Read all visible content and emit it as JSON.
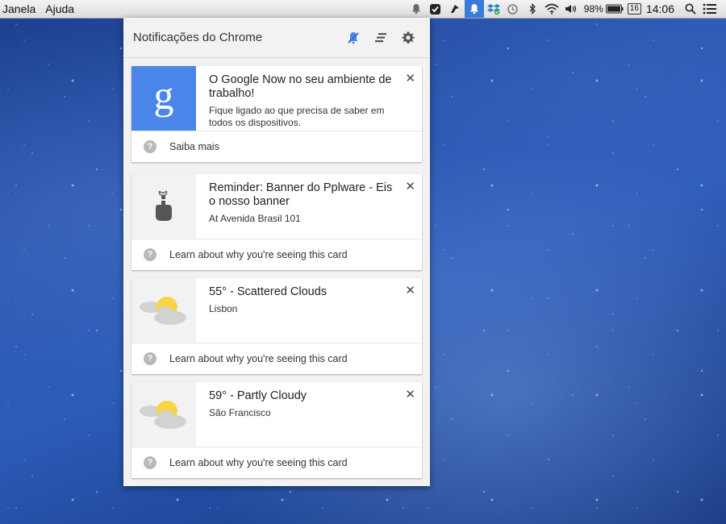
{
  "menubar": {
    "items": [
      "Janela",
      "Ajuda"
    ],
    "battery": "98%",
    "calendar_day": "16",
    "clock": "14:06"
  },
  "panel": {
    "title": "Notificações do Chrome"
  },
  "cards": [
    {
      "title": "O Google Now no seu ambiente de trabalho!",
      "message": "Fique ligado ao que precisa de saber em todos os dispositivos.",
      "footer": "Saiba mais",
      "icon": "google-g-icon"
    },
    {
      "title": "Reminder: Banner do Pplware - Eis o nosso banner",
      "message": "At Avenida Brasil 101",
      "footer": "Learn about why you're seeing this card",
      "icon": "reminder-finger-icon"
    },
    {
      "title": "55° - Scattered Clouds",
      "message": "Lisbon",
      "footer": "Learn about why you're seeing this card",
      "icon": "partly-cloudy-icon"
    },
    {
      "title": "59° - Partly Cloudy",
      "message": "São Francisco",
      "footer": "Learn about why you're seeing this card",
      "icon": "partly-cloudy-icon"
    }
  ],
  "colors": {
    "google_blue": "#4a85ea",
    "tray_highlight": "#3a7bd5"
  }
}
